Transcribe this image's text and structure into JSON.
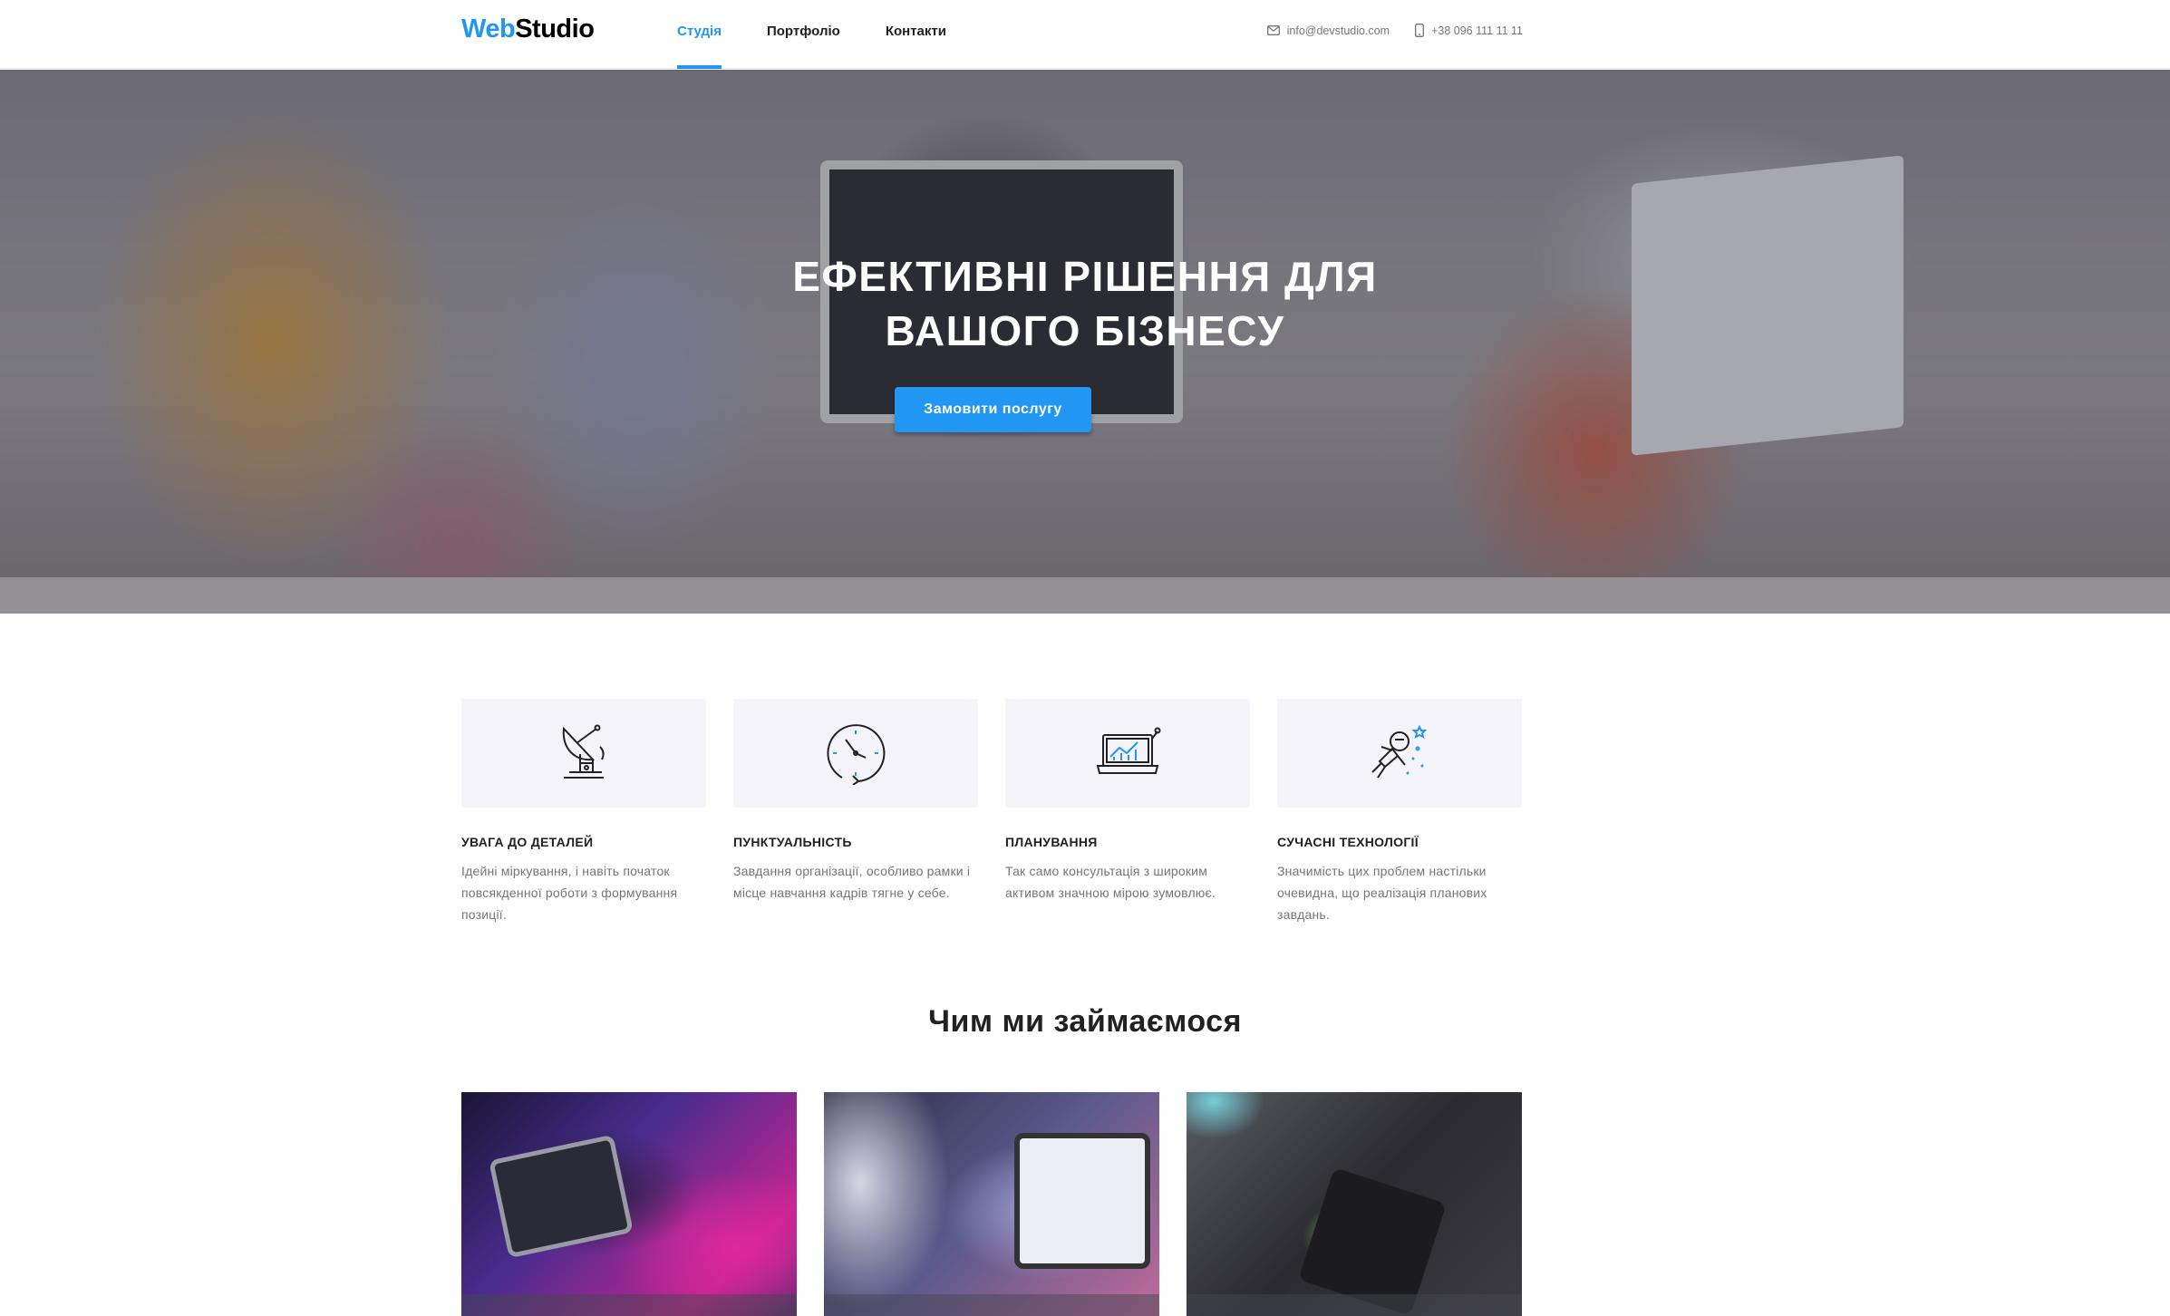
{
  "brand": {
    "part1": "Web",
    "part2": "Studio",
    "accent_color": "#2196f3"
  },
  "nav": {
    "items": [
      {
        "label": "Студія",
        "active": true
      },
      {
        "label": "Портфоліо",
        "active": false
      },
      {
        "label": "Контакти",
        "active": false
      }
    ]
  },
  "contacts": {
    "email": "info@devstudio.com",
    "email_icon": "mail-icon",
    "phone": "+38 096 111 11 11",
    "phone_icon": "phone-icon"
  },
  "hero": {
    "title_line1": "ЕФЕКТИВНІ РІШЕННЯ ДЛЯ",
    "title_line2": "ВАШОГО БІЗНЕСУ",
    "button_label": "Замовити послугу"
  },
  "features": [
    {
      "icon": "satellite-dish-icon",
      "title": "УВАГА ДО ДЕТАЛЕЙ",
      "text": "Ідейні міркування, і навіть початок повсякденної роботи з формування позиції."
    },
    {
      "icon": "clock-icon",
      "title": "ПУНКТУАЛЬНІСТЬ",
      "text": "Завдання організації, особливо рамки і місце навчання кадрів тягне у себе."
    },
    {
      "icon": "laptop-chart-icon",
      "title": "ПЛАНУВАННЯ",
      "text": "Так само консультація з широким активом значною мірою зумовлює."
    },
    {
      "icon": "astronaut-icon",
      "title": "СУЧАСНІ ТЕХНОЛОГІЇ",
      "text": "Значимість цих проблем настільки очевидна, що реалізація планових завдань."
    }
  ],
  "services": {
    "title": "Чим ми займаємося"
  }
}
